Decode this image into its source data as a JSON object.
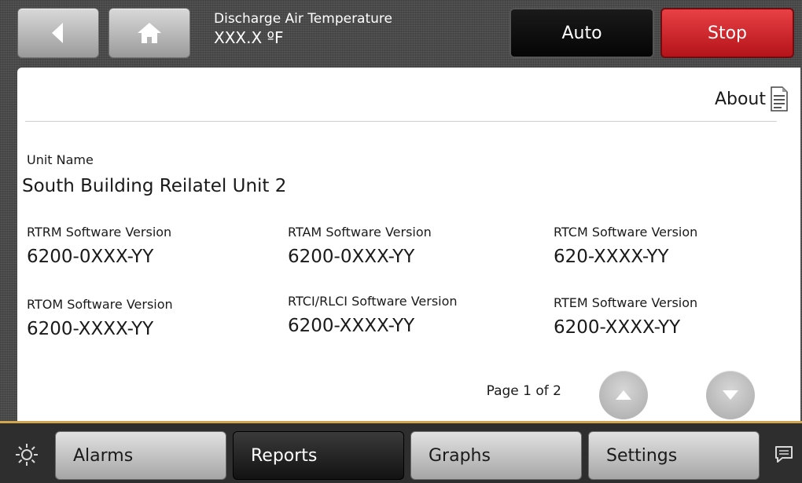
{
  "header": {
    "title": "Discharge Air Temperature",
    "value": "XXX.X ºF",
    "auto_label": "Auto",
    "stop_label": "Stop"
  },
  "page": {
    "title": "About",
    "unit_name_label": "Unit Name",
    "unit_name_value": "South Building Reilatel Unit 2",
    "versions": [
      {
        "label": "RTRM Software Version",
        "value": "6200-0XXX-YY"
      },
      {
        "label": "RTAM Software Version",
        "value": "6200-0XXX-YY"
      },
      {
        "label": "RTCM Software Version",
        "value": "620-XXXX-YY"
      },
      {
        "label": "RTOM Software Version",
        "value": "6200-XXXX-YY"
      },
      {
        "label": "RTCI/RLCI Software Version",
        "value": "6200-XXXX-YY"
      },
      {
        "label": "RTEM Software Version",
        "value": "6200-XXXX-YY"
      }
    ],
    "pager": "Page 1 of 2"
  },
  "footer": {
    "tabs": [
      {
        "label": "Alarms"
      },
      {
        "label": "Reports"
      },
      {
        "label": "Graphs"
      },
      {
        "label": "Settings"
      }
    ],
    "active_tab": "Reports"
  },
  "colors": {
    "stop_red": "#c21f24",
    "footer_accent": "#d2a64f"
  },
  "icons": [
    "back-arrow-icon",
    "home-icon",
    "document-icon",
    "brightness-icon",
    "chat-icon",
    "up-arrow-icon",
    "down-arrow-icon"
  ]
}
